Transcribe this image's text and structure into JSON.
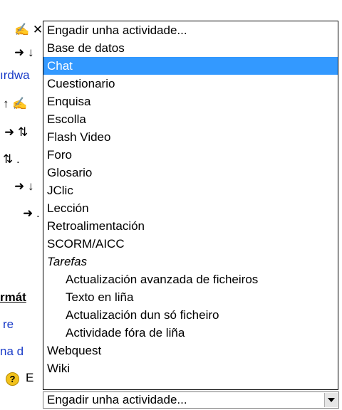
{
  "background": {
    "row1": "✍ ✕",
    "row2": "➜ ↓",
    "row3": "ırdwa",
    "row4": "↑ ✍",
    "row5": "➜ ⇅",
    "row6": "⇅ .",
    "row7": "➜ ↓",
    "row8": "➜ .",
    "heading": "rmát",
    "link1": "re",
    "link2": "na d",
    "help_letter": "?",
    "field_letter": "E"
  },
  "activity_select": {
    "selected_label": "Engadir unha actividade...",
    "options": [
      {
        "label": "Engadir unha actividade...",
        "kind": "option"
      },
      {
        "label": "Base de datos",
        "kind": "option"
      },
      {
        "label": "Chat",
        "kind": "option",
        "highlighted": true
      },
      {
        "label": "Cuestionario",
        "kind": "option"
      },
      {
        "label": "Enquisa",
        "kind": "option"
      },
      {
        "label": "Escolla",
        "kind": "option"
      },
      {
        "label": "Flash Video",
        "kind": "option"
      },
      {
        "label": "Foro",
        "kind": "option"
      },
      {
        "label": "Glosario",
        "kind": "option"
      },
      {
        "label": "JClic",
        "kind": "option"
      },
      {
        "label": "Lección",
        "kind": "option"
      },
      {
        "label": "Retroalimentación",
        "kind": "option"
      },
      {
        "label": "SCORM/AICC",
        "kind": "option"
      },
      {
        "label": "Tarefas",
        "kind": "group"
      },
      {
        "label": "Actualización avanzada de ficheiros",
        "kind": "child"
      },
      {
        "label": "Texto en liña",
        "kind": "child"
      },
      {
        "label": "Actualización dun só ficheiro",
        "kind": "child"
      },
      {
        "label": "Actividade fóra de liña",
        "kind": "child"
      },
      {
        "label": "Webquest",
        "kind": "option"
      },
      {
        "label": "Wiki",
        "kind": "option"
      }
    ]
  },
  "colors": {
    "highlight": "#3399ff",
    "link": "#1a3cc8"
  },
  "icons": {
    "dropdown_arrow": "chevron-down-icon",
    "help": "help-icon"
  }
}
